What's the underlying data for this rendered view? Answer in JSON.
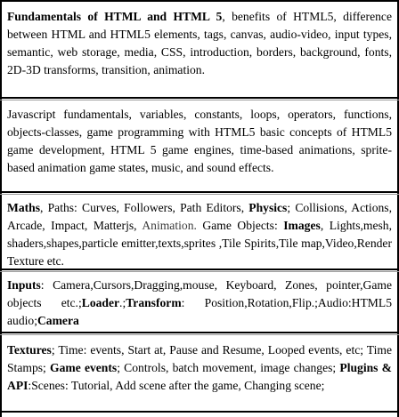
{
  "rows": [
    {
      "segments": [
        {
          "text": "Fundamentals of HTML and HTML 5",
          "bold": true
        },
        {
          "text": ", benefits of HTML5, difference between HTML and HTML5 elements, tags, canvas, audio-video, input types, semantic, web storage, media, CSS, introduction, borders, background, fonts, 2D-3D transforms, transition, animation.",
          "bold": false
        }
      ]
    },
    {
      "segments": [
        {
          "text": "Javascript fundamentals, variables, constants, loops, operators, functions, objects-classes, game programming with HTML5 basic concepts of HTML5 game development, HTML 5 game engines, time-based animations, sprite-based animation game states, music, and sound effects.",
          "bold": false
        }
      ]
    },
    {
      "segments": [
        {
          "text": "Maths",
          "bold": true
        },
        {
          "text": ", Paths: Curves, Followers, Path Editors, ",
          "bold": false
        },
        {
          "text": "Physics",
          "bold": true
        },
        {
          "text": "; Collisions, Actions, Arcade, Impact, Matterjs, ",
          "bold": false
        },
        {
          "text": "Animation.",
          "bold": false,
          "muted": true
        },
        {
          "text": " Game Objects: ",
          "bold": false
        },
        {
          "text": "Images",
          "bold": true
        },
        {
          "text": ", Lights,mesh, shaders,shapes,particle emitter,texts,sprites ,Tile Spirits,Tile map,Video,Render Texture etc.",
          "bold": false
        }
      ]
    },
    {
      "segments": [
        {
          "text": "Inputs",
          "bold": true
        },
        {
          "text": ": Camera,Cursors,Dragging,mouse, Keyboard, Zones, pointer,Game objects etc.;",
          "bold": false
        },
        {
          "text": "Loader",
          "bold": true
        },
        {
          "text": ".;",
          "bold": false
        },
        {
          "text": "Transform",
          "bold": true
        },
        {
          "text": ": Position,Rotation,Flip.;Audio:HTML5 audio;",
          "bold": false
        },
        {
          "text": "Camera",
          "bold": true
        }
      ]
    },
    {
      "segments": [
        {
          "text": "Textures",
          "bold": true
        },
        {
          "text": "; Time: events, Start at, Pause and Resume, Looped events, etc; Time Stamps; ",
          "bold": false
        },
        {
          "text": "Game events",
          "bold": true
        },
        {
          "text": "; Controls, batch movement, image changes; ",
          "bold": false
        },
        {
          "text": "Plugins & API",
          "bold": true
        },
        {
          "text": ":Scenes: Tutorial, Add scene after the game, Changing scene;",
          "bold": false
        }
      ]
    }
  ]
}
